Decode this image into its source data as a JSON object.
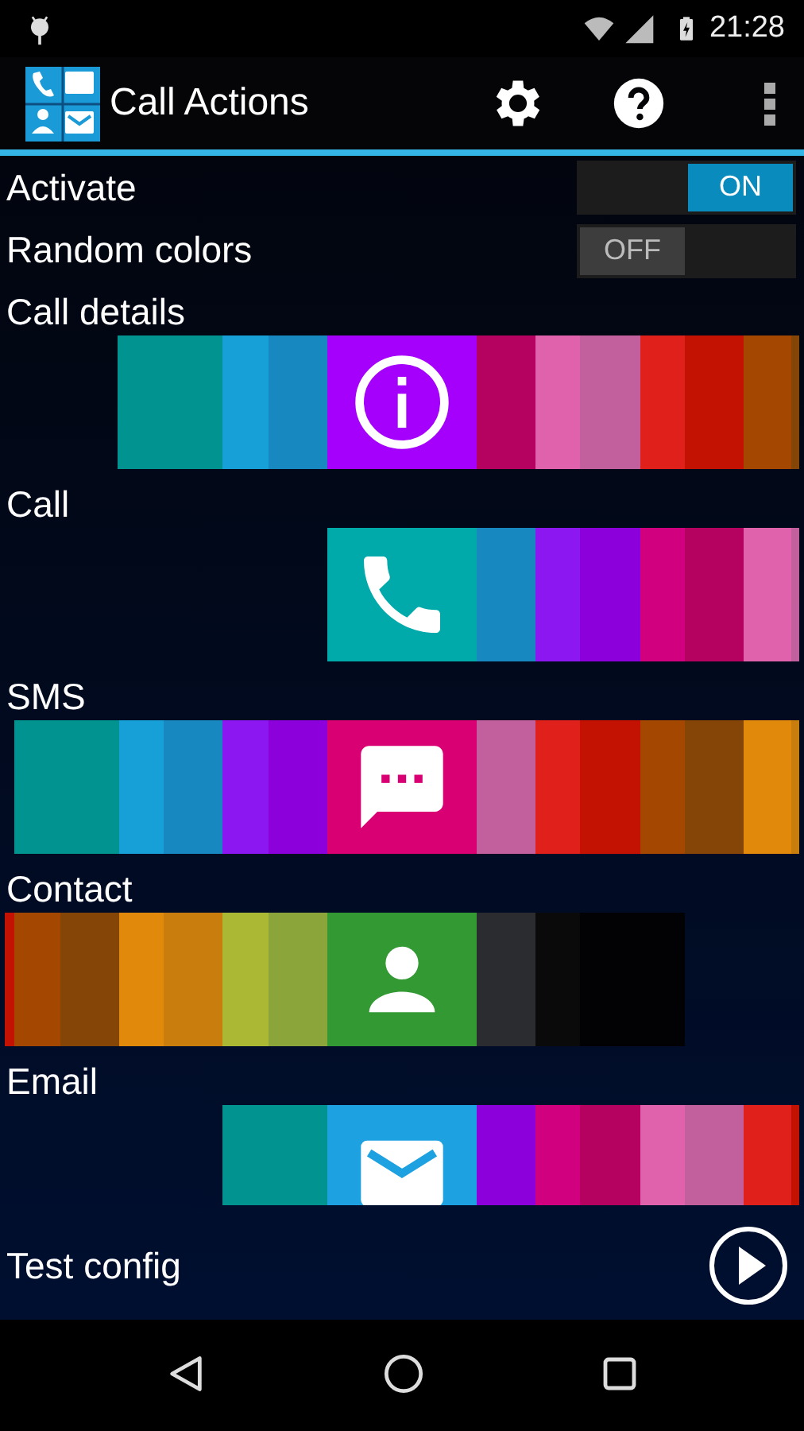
{
  "status_bar": {
    "time": "21:28"
  },
  "app_bar": {
    "title": "Call Actions"
  },
  "settings": [
    {
      "label": "Activate",
      "on": true,
      "state_text": "ON"
    },
    {
      "label": "Random colors",
      "on": false,
      "state_text": "OFF"
    }
  ],
  "actions": [
    {
      "label": "Call details",
      "kind": "info",
      "color": "#a400fb",
      "left": [
        {
          "color": "#009390"
        },
        {
          "color": "#17a0d8"
        },
        {
          "color": "#1789c0"
        }
      ],
      "right": [
        {
          "color": "#b50160"
        },
        {
          "color": "#e062ac"
        },
        {
          "color": "#c2609e"
        },
        {
          "color": "#e0201a"
        },
        {
          "color": "#c31201"
        },
        {
          "color": "#a34701"
        },
        {
          "color": "#854507"
        }
      ]
    },
    {
      "label": "Call",
      "kind": "phone",
      "color": "#00aaaa",
      "right": [
        {
          "color": "#1789c0"
        },
        {
          "color": "#8d17f0"
        },
        {
          "color": "#8c00dc"
        },
        {
          "color": "#d0007f"
        },
        {
          "color": "#b50160"
        },
        {
          "color": "#e062ac"
        },
        {
          "color": "#c2609e"
        }
      ]
    },
    {
      "label": "SMS",
      "kind": "sms",
      "color": "#d90074",
      "left": [
        {
          "color": "#009390"
        },
        {
          "color": "#17a0d8"
        },
        {
          "color": "#1789c0"
        },
        {
          "color": "#8d17f0"
        },
        {
          "color": "#8c00dc"
        }
      ],
      "right": [
        {
          "color": "#c2609e"
        },
        {
          "color": "#e0201a"
        },
        {
          "color": "#c31201"
        },
        {
          "color": "#a34701"
        },
        {
          "color": "#854507"
        },
        {
          "color": "#e0890a"
        },
        {
          "color": "#c87d0c"
        }
      ]
    },
    {
      "label": "Contact",
      "kind": "contact",
      "color": "#339933",
      "left": [
        {
          "color": "#c31201"
        },
        {
          "color": "#a34701"
        },
        {
          "color": "#854507"
        },
        {
          "color": "#e0890a"
        },
        {
          "color": "#c87d0c"
        },
        {
          "color": "#abb834"
        },
        {
          "color": "#8ba53a"
        }
      ],
      "right": [
        {
          "color": "#2b2c30"
        },
        {
          "color": "#0a0a0a"
        },
        {
          "color": "#020205"
        }
      ]
    },
    {
      "label": "Email",
      "kind": "email",
      "color": "#1ea1e0",
      "left": [
        {
          "color": "#009390"
        }
      ],
      "right": [
        {
          "color": "#8c00dc"
        },
        {
          "color": "#d0007f"
        },
        {
          "color": "#b50160"
        },
        {
          "color": "#e062ac"
        },
        {
          "color": "#c2609e"
        },
        {
          "color": "#e0201a"
        },
        {
          "color": "#c31201"
        }
      ]
    }
  ],
  "test": {
    "label": "Test config"
  }
}
